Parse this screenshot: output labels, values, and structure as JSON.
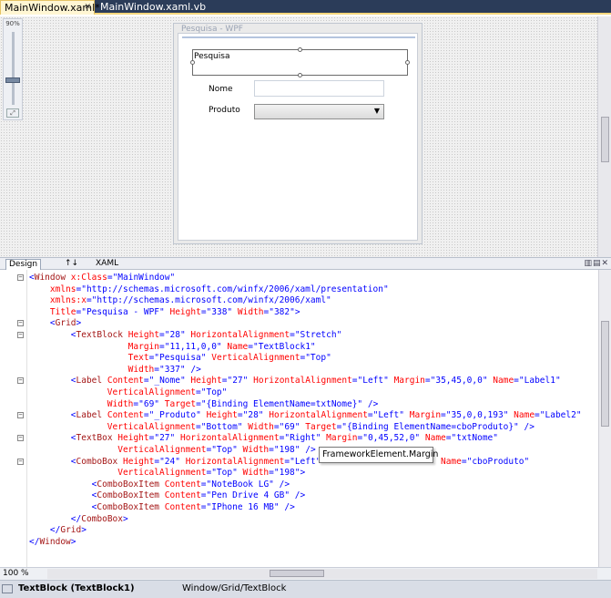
{
  "tabs": [
    {
      "label": "MainWindow.xaml*",
      "active": true
    },
    {
      "label": "MainWindow.xaml.vb",
      "active": false
    }
  ],
  "design": {
    "zoom_indicator": "90%",
    "window_title": "Pesquisa - WPF",
    "textblock_text": "Pesquisa",
    "label_nome": "Nome",
    "label_produto": "Produto",
    "textbox_value": "",
    "combobox_value": ""
  },
  "split": {
    "design_tab": "Design",
    "swap_label": "↑↓",
    "xaml_tab": "XAML"
  },
  "code_lines": [
    "<Window x:Class=\"MainWindow\"",
    "    xmlns=\"http://schemas.microsoft.com/winfx/2006/xaml/presentation\"",
    "    xmlns:x=\"http://schemas.microsoft.com/winfx/2006/xaml\"",
    "    Title=\"Pesquisa - WPF\" Height=\"338\" Width=\"382\">",
    "    <Grid>",
    "        <TextBlock Height=\"28\" HorizontalAlignment=\"Stretch\"",
    "                   Margin=\"11,11,0,0\" Name=\"TextBlock1\"",
    "                   Text=\"Pesquisa\" VerticalAlignment=\"Top\"",
    "                   Width=\"337\" />",
    "        <Label Content=\"_Nome\" Height=\"27\" HorizontalAlignment=\"Left\" Margin=\"35,45,0,0\" Name=\"Label1\"",
    "               VerticalAlignment=\"Top\"",
    "               Width=\"69\" Target=\"{Binding ElementName=txtNome}\" />",
    "        <Label Content=\"_Produto\" Height=\"28\" HorizontalAlignment=\"Left\" Margin=\"35,0,0,193\" Name=\"Label2\"",
    "               VerticalAlignment=\"Bottom\" Width=\"69\" Target=\"{Binding ElementName=cboProduto}\" />",
    "        <TextBox Height=\"27\" HorizontalAlignment=\"Right\" Margin=\"0,45,52,0\" Name=\"txtNome\"",
    "                 VerticalAlignment=\"Top\" Width=\"198\" />",
    "        <ComboBox Height=\"24\" HorizontalAlignment=\"Left\"                       Name=\"cboProduto\"",
    "                 VerticalAlignment=\"Top\" Width=\"198\">",
    "            <ComboBoxItem Content=\"NoteBook LG\" />",
    "            <ComboBoxItem Content=\"Pen Drive 4 GB\" />",
    "            <ComboBoxItem Content=\"IPhone 16 MB\" />",
    "        </ComboBox>",
    "    </Grid>",
    "</Window>"
  ],
  "tooltip": "FrameworkElement.Margin",
  "zoom": "100 %",
  "status": {
    "selected": "TextBlock (TextBlock1)",
    "breadcrumb": "Window/Grid/TextBlock"
  }
}
